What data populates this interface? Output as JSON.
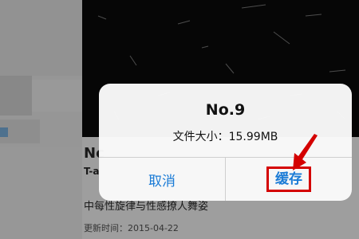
{
  "dialog": {
    "title": "No.9",
    "message": "文件大小：15.99MB",
    "cancel_label": "取消",
    "cache_label": "缓存"
  },
  "background": {
    "item_title_fragment": "Nc",
    "item_subtitle_fragment": "T-a",
    "description": "中每性旋律与性感撩人舞姿",
    "update_time": "更新时间：2015-04-22"
  },
  "colors": {
    "link_blue": "#1a7bd6",
    "annotation_red": "#d40000",
    "video_bg": "#0b0b0b"
  },
  "icons": {
    "annotation": "red-arrow-icon"
  }
}
